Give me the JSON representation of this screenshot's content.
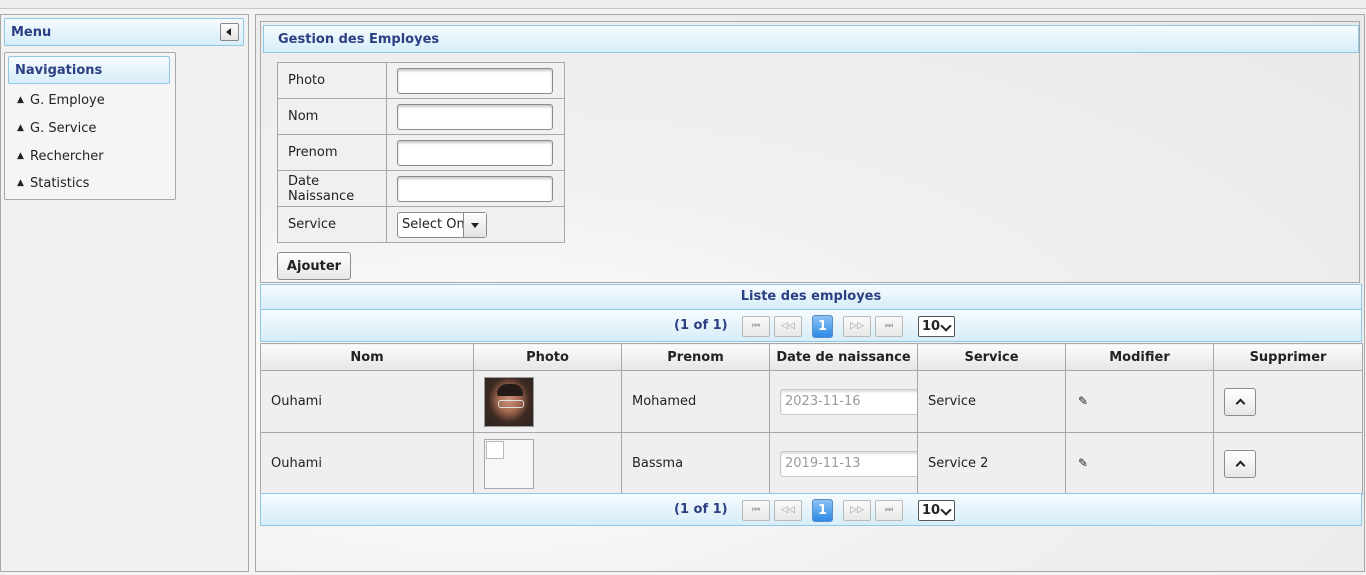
{
  "menu": {
    "title": "Menu",
    "section_title": "Navigations",
    "items": [
      {
        "label": "G. Employe"
      },
      {
        "label": "G. Service"
      },
      {
        "label": "Rechercher"
      },
      {
        "label": "Statistics"
      }
    ]
  },
  "form": {
    "title": "Gestion des Employes",
    "fields": {
      "photo": {
        "label": "Photo",
        "value": ""
      },
      "nom": {
        "label": "Nom",
        "value": ""
      },
      "prenom": {
        "label": "Prenom",
        "value": ""
      },
      "date_naissance": {
        "label": "Date Naissance",
        "value": ""
      },
      "service": {
        "label": "Service",
        "selected": "Select One"
      }
    },
    "submit_label": "Ajouter"
  },
  "table": {
    "title": "Liste des employes",
    "paginator": {
      "count_text": "(1 of 1)",
      "current_page": "1",
      "first": "⏮",
      "prev": "◁◁",
      "next": "▷▷",
      "last": "⏭",
      "rows_per_page": "10"
    },
    "columns": [
      "Nom",
      "Photo",
      "Prenom",
      "Date de naissance",
      "Service",
      "Modifier",
      "Supprimer"
    ],
    "rows": [
      {
        "nom": "Ouhami",
        "photo": "photo-portrait",
        "prenom": "Mohamed",
        "date": "2023-11-16",
        "service": "Service"
      },
      {
        "nom": "Ouhami",
        "photo": "broken-image",
        "prenom": "Bassma",
        "date": "2019-11-13",
        "service": "Service 2"
      }
    ],
    "icons": {
      "edit": "pencil-icon",
      "delete": "chevron-up-icon"
    }
  },
  "colors": {
    "header_text": "#2b3f83",
    "header_border": "#8ec8e5",
    "active_page": "#2e8ae3"
  }
}
